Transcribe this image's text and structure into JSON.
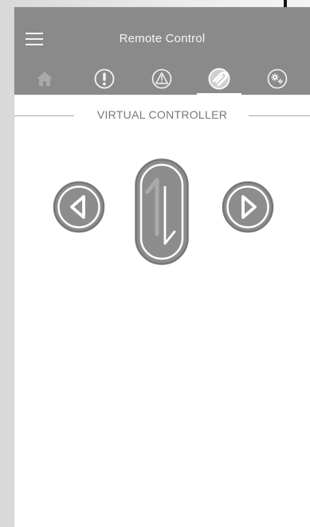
{
  "header": {
    "title": "Remote Control"
  },
  "tabs": [
    {
      "id": "home",
      "icon": "home-icon",
      "active": false
    },
    {
      "id": "alerts",
      "icon": "exclamation-circle-icon",
      "active": false
    },
    {
      "id": "warnings",
      "icon": "warning-triangle-icon",
      "active": false
    },
    {
      "id": "remote",
      "icon": "remote-control-icon",
      "active": true
    },
    {
      "id": "settings",
      "icon": "gears-icon",
      "active": false
    }
  ],
  "section": {
    "label": "VIRTUAL CONTROLLER"
  },
  "controls": {
    "left": "left-arrow-icon",
    "up_down": "up-down-arrows-icon",
    "right": "right-arrow-icon"
  },
  "colors": {
    "header": "#8a8a8a",
    "icon": "#f4f4f4",
    "control_fill": "#8d8d8d",
    "control_outline": "#777777",
    "control_glyph": "#ffffff",
    "divider": "#a8a8a8"
  }
}
